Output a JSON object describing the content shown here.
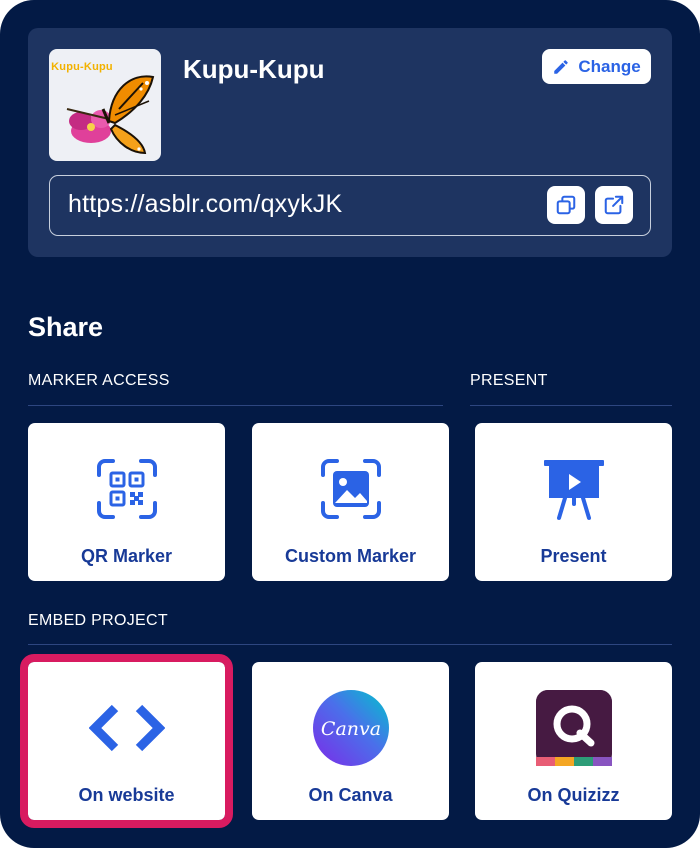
{
  "project": {
    "name": "Kupu-Kupu",
    "thumbnail_text": "Kupu-Kupu",
    "change_label": "Change",
    "url": "https://asblr.com/qxykJK"
  },
  "share": {
    "title": "Share",
    "sections": {
      "marker_access": "MARKER ACCESS",
      "present": "PRESENT",
      "embed": "EMBED PROJECT"
    },
    "tiles": {
      "qr_marker": "QR Marker",
      "custom_marker": "Custom Marker",
      "present": "Present",
      "on_website": "On website",
      "on_canva": "On Canva",
      "on_quizizz": "On Quizizz"
    },
    "canva_logo_text": "Canva"
  },
  "colors": {
    "background": "#031a45",
    "card": "#1e3461",
    "accent": "#2b63e5",
    "selected": "#d81b60"
  }
}
